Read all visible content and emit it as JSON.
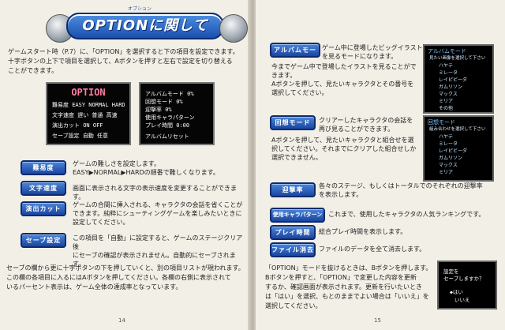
{
  "title": {
    "ruby": "オプション",
    "text": "OPTIONに関して"
  },
  "left_page": {
    "intro": [
      "ゲームスタート時（P.7）に、「OPTION」を選択すると下の項目を設定できます。",
      "十字ボタンの上下で項目を選択して、Aボタンを押すと左右で設定を切り替える",
      "ことができます。"
    ],
    "option_screen": {
      "title": "OPTION",
      "rows": [
        {
          "label": "難易度",
          "values": "EASY NORMAL HARD",
          "hl": "NORMAL"
        },
        {
          "label": "文字速度",
          "values": "遅い 普通 高速",
          "hl": "普通"
        },
        {
          "label": "演出カット",
          "values": "ON OFF",
          "hl": "OFF"
        },
        {
          "label": "セーブ設定",
          "values": "自動 任意",
          "hl": "任意"
        }
      ]
    },
    "stats_screen": {
      "rows": [
        "アルバムモード 0%",
        "回想モード 0%",
        "迎撃率 0%",
        "使用キャラパターン",
        "プレイ時間 0:00",
        "アルバムリセット"
      ]
    },
    "items": [
      {
        "badge": "難易度",
        "desc": [
          "ゲームの難しさを設定します。",
          "EASY▶NORMAL▶HARDの順番で難しくなります。"
        ]
      },
      {
        "badge": "文字速度",
        "desc": [
          "画面に表示される文字の表示速度を変更することができます。"
        ]
      },
      {
        "badge": "演出カット",
        "desc": [
          "ゲームの合間に挿入される、キャラクタの会話を省くことが",
          "できます。純粋にシューティングゲームを楽しみたいときに",
          "設定してください。"
        ]
      },
      {
        "badge": "セーブ設定",
        "desc": [
          "この項目を「自動」に設定すると、ゲームのステージクリア後",
          "にセーブの確認が表示されません。自動的にセーブされます。"
        ]
      }
    ],
    "footer": [
      "セーブの欄から更に十字ボタンの下を押していくと、別の項目リストが現われます。",
      "この欄の各項目に入るにはAボタンを押してください。各欄の右側に表示されて",
      "いるパーセント表示は、ゲーム全体の達成率となっています。"
    ],
    "page_no": "14"
  },
  "right_page": {
    "items": [
      {
        "badge": "アルバムモード",
        "desc": [
          "ゲーム中に登場したビッグイラスト",
          "を見るモードになります。",
          "今までゲーム中で登場したイラストを見ることがで",
          "きます。",
          "Aボタンを押して、見たいキャラクタとその番号を",
          "選択してください。"
        ]
      },
      {
        "badge": "回想モード",
        "desc": [
          "クリアーしたキャラクタの会話を",
          "再び見ることができます。",
          "Aボタンを押して、見たいキャラクタと組合せを選",
          "択してください。それまでにクリアした組合せしか",
          "選択できません。"
        ]
      },
      {
        "badge": "迎撃率",
        "desc": [
          "各々のステージ、もしくはトータルでのそれぞれの迎撃率",
          "を表示します。"
        ]
      },
      {
        "badge": "使用キャラパターン",
        "desc": [
          "これまで、使用したキャラクタの人気ランキングです。"
        ]
      },
      {
        "badge": "プレイ時間",
        "desc": [
          "総合プレイ時間を表示します。"
        ]
      },
      {
        "badge": "ファイル消去",
        "desc": [
          "ファイルのデータを全て消去します。"
        ]
      }
    ],
    "album_screen": {
      "head": "アルバムモード",
      "sub": "見たい画像を選択して下さい",
      "list": [
        "ハヤテ",
        "ミレータ",
        "レイピビーダ",
        "ガムリソン",
        "マックス",
        "ミリア",
        "その他"
      ]
    },
    "recall_screen": {
      "head": "回想モード",
      "sub": "組み合わせを選択して下さい",
      "list": [
        "ハヤテ",
        "ミレータ",
        "レイピビーダ",
        "ガムリソン",
        "マックス",
        "ミリア"
      ]
    },
    "footer": [
      "「OPTION」モードを抜けるときは、Bボタンを押します。",
      "Bボタンを押すと、「OPTION」で変更した内容を更新",
      "するか、確認画面が表示されます。更新を行いたいとき",
      "は「はい」を選択、もとのままでよい場合は「いいえ」を",
      "選択してください。"
    ],
    "save_screen": {
      "q1": "設定を",
      "q2": "セーブしますか？",
      "yes": "◆はい",
      "no": "いいえ"
    },
    "page_no": "15"
  }
}
